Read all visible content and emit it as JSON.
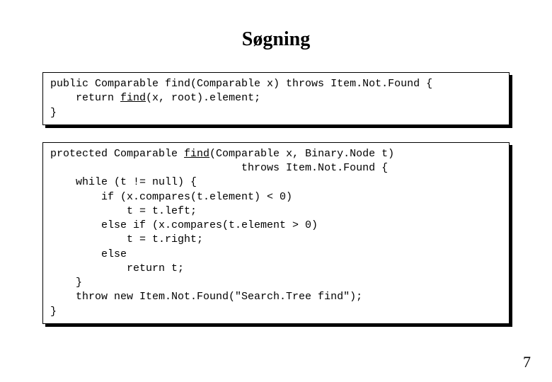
{
  "title": "Søgning",
  "code1": {
    "line1_a": "public Comparable find(Comparable x) throws Item.Not.Found {",
    "line2_a": "    return ",
    "line2_b": "find",
    "line2_c": "(x, root).element;",
    "line3_a": "}"
  },
  "code2": {
    "line1_a": "protected Comparable ",
    "line1_b": "find",
    "line1_c": "(Comparable x, Binary.Node t) ",
    "line2_a": "                              throws Item.Not.Found {",
    "line3_a": "    while (t != null) {",
    "line4_a": "        if (x.compares(t.element) < 0)",
    "line5_a": "            t = t.left;",
    "line6_a": "        else if (x.compares(t.element > 0)",
    "line7_a": "            t = t.right;",
    "line8_a": "        else",
    "line9_a": "            return t;",
    "line10_a": "    }",
    "line11_a": "    throw new Item.Not.Found(\"Search.Tree find\");",
    "line12_a": "}"
  },
  "page_number": "7"
}
